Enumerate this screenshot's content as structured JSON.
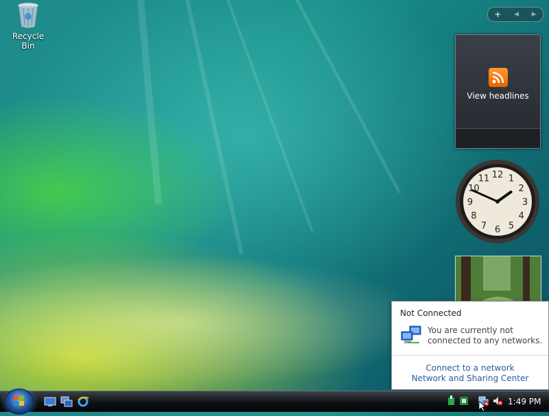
{
  "desktop": {
    "icons": [
      {
        "label": "Recycle Bin",
        "icon": "recycle-bin-icon"
      }
    ]
  },
  "sidebar": {
    "controls": {
      "add": "+",
      "prev": "◀",
      "next": "▶"
    },
    "feed": {
      "label": "View headlines",
      "icon": "rss-icon",
      "accent": "#f08a24"
    },
    "clock": {
      "numbers": [
        "12",
        "1",
        "2",
        "3",
        "4",
        "5",
        "6",
        "7",
        "8",
        "9",
        "10",
        "11"
      ],
      "hour": 1,
      "minute": 49
    }
  },
  "notification": {
    "title": "Not Connected",
    "message": "You are currently not connected to any networks.",
    "links": [
      "Connect to a network",
      "Network and Sharing Center"
    ]
  },
  "taskbar": {
    "time": "1:49 PM"
  }
}
